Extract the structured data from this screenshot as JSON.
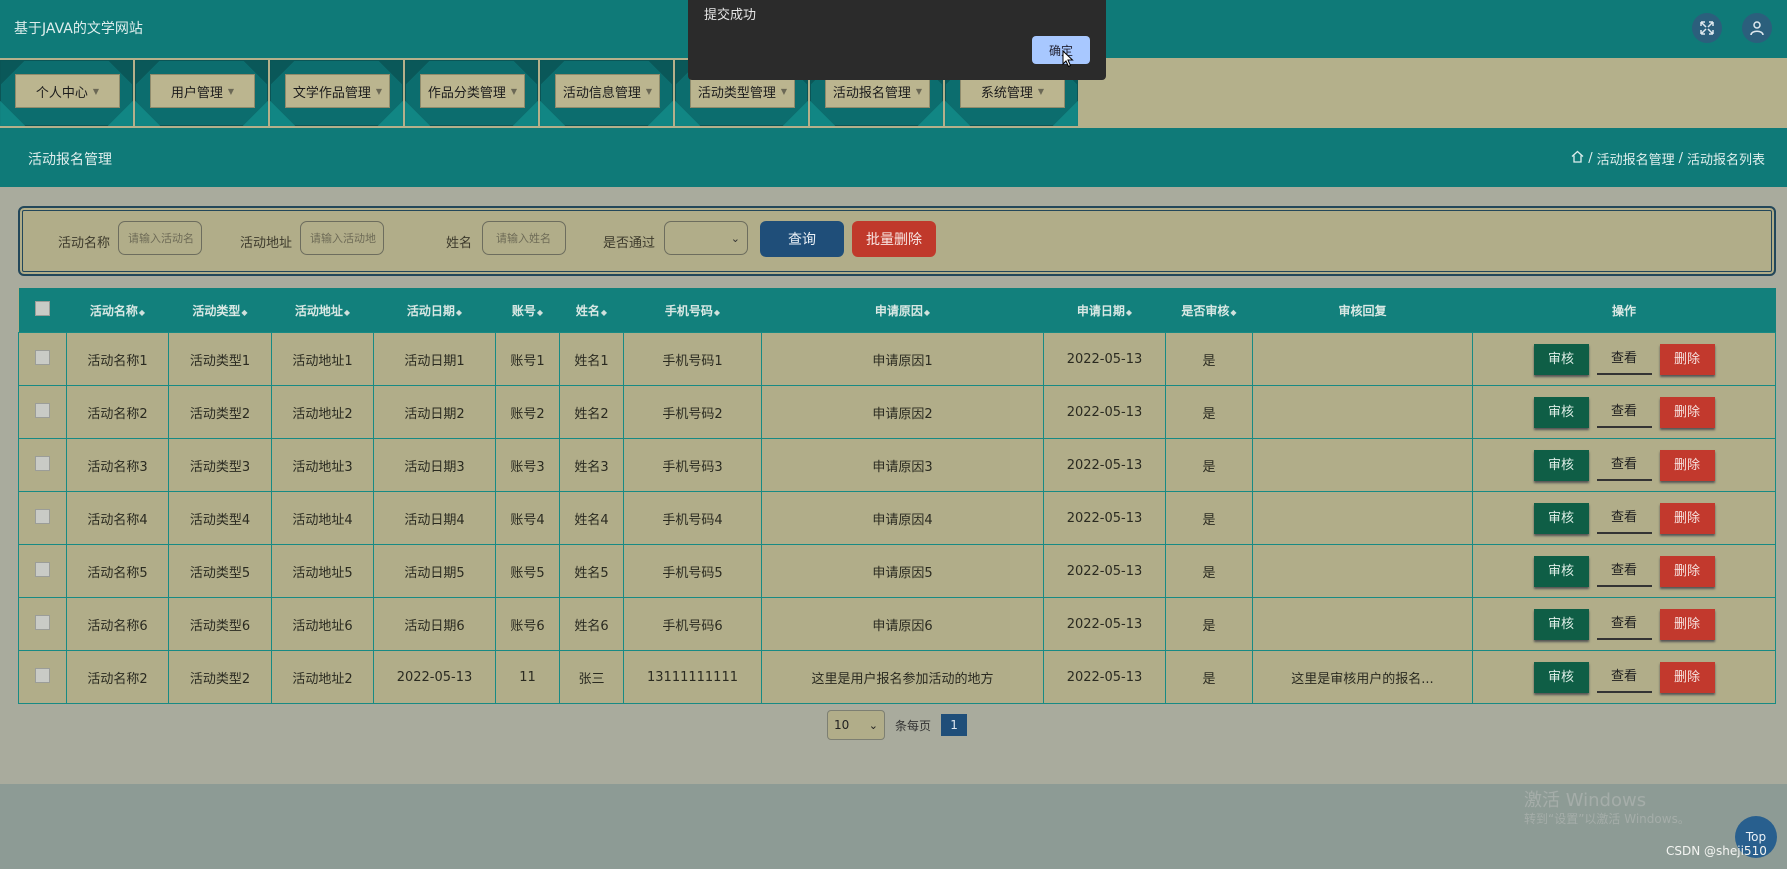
{
  "app": {
    "title": "基于JAVA的文学网站"
  },
  "header": {
    "fullscreen_icon": "fullscreen-icon",
    "user_icon": "user-icon"
  },
  "nav": [
    {
      "label": "个人中心"
    },
    {
      "label": "用户管理"
    },
    {
      "label": "文学作品管理"
    },
    {
      "label": "作品分类管理"
    },
    {
      "label": "活动信息管理"
    },
    {
      "label": "活动类型管理"
    },
    {
      "label": "活动报名管理"
    },
    {
      "label": "系统管理"
    }
  ],
  "page": {
    "title": "活动报名管理",
    "breadcrumb": [
      "活动报名管理",
      "活动报名列表"
    ]
  },
  "search": {
    "name_label": "活动名称",
    "name_placeholder": "请输入活动名",
    "addr_label": "活动地址",
    "addr_placeholder": "请输入活动地",
    "user_label": "姓名",
    "user_placeholder": "请输入姓名",
    "pass_label": "是否通过",
    "pass_value": "",
    "query": "查询",
    "batch_delete": "批量删除"
  },
  "table": {
    "headers": [
      "",
      "活动名称",
      "活动类型",
      "活动地址",
      "活动日期",
      "账号",
      "姓名",
      "手机号码",
      "申请原因",
      "申请日期",
      "是否审核",
      "审核回复",
      "操作"
    ],
    "actions": {
      "audit": "审核",
      "view": "查看",
      "delete": "删除"
    },
    "rows": [
      [
        "活动名称1",
        "活动类型1",
        "活动地址1",
        "活动日期1",
        "账号1",
        "姓名1",
        "手机号码1",
        "申请原因1",
        "2022-05-13",
        "是",
        ""
      ],
      [
        "活动名称2",
        "活动类型2",
        "活动地址2",
        "活动日期2",
        "账号2",
        "姓名2",
        "手机号码2",
        "申请原因2",
        "2022-05-13",
        "是",
        ""
      ],
      [
        "活动名称3",
        "活动类型3",
        "活动地址3",
        "活动日期3",
        "账号3",
        "姓名3",
        "手机号码3",
        "申请原因3",
        "2022-05-13",
        "是",
        ""
      ],
      [
        "活动名称4",
        "活动类型4",
        "活动地址4",
        "活动日期4",
        "账号4",
        "姓名4",
        "手机号码4",
        "申请原因4",
        "2022-05-13",
        "是",
        ""
      ],
      [
        "活动名称5",
        "活动类型5",
        "活动地址5",
        "活动日期5",
        "账号5",
        "姓名5",
        "手机号码5",
        "申请原因5",
        "2022-05-13",
        "是",
        ""
      ],
      [
        "活动名称6",
        "活动类型6",
        "活动地址6",
        "活动日期6",
        "账号6",
        "姓名6",
        "手机号码6",
        "申请原因6",
        "2022-05-13",
        "是",
        ""
      ],
      [
        "活动名称2",
        "活动类型2",
        "活动地址2",
        "2022-05-13",
        "11",
        "张三",
        "13111111111",
        "这里是用户报名参加活动的地方",
        "2022-05-13",
        "是",
        "这里是审核用户的报名..."
      ]
    ]
  },
  "pager": {
    "page_size": "10",
    "per_page_label": "条每页",
    "current": "1"
  },
  "dialog": {
    "message": "提交成功",
    "ok": "确定"
  },
  "watermark": {
    "line1": "激活 Windows",
    "line2": "转到“设置”以激活 Windows。"
  },
  "top_button": "Top",
  "credit": "CSDN @sheji510"
}
